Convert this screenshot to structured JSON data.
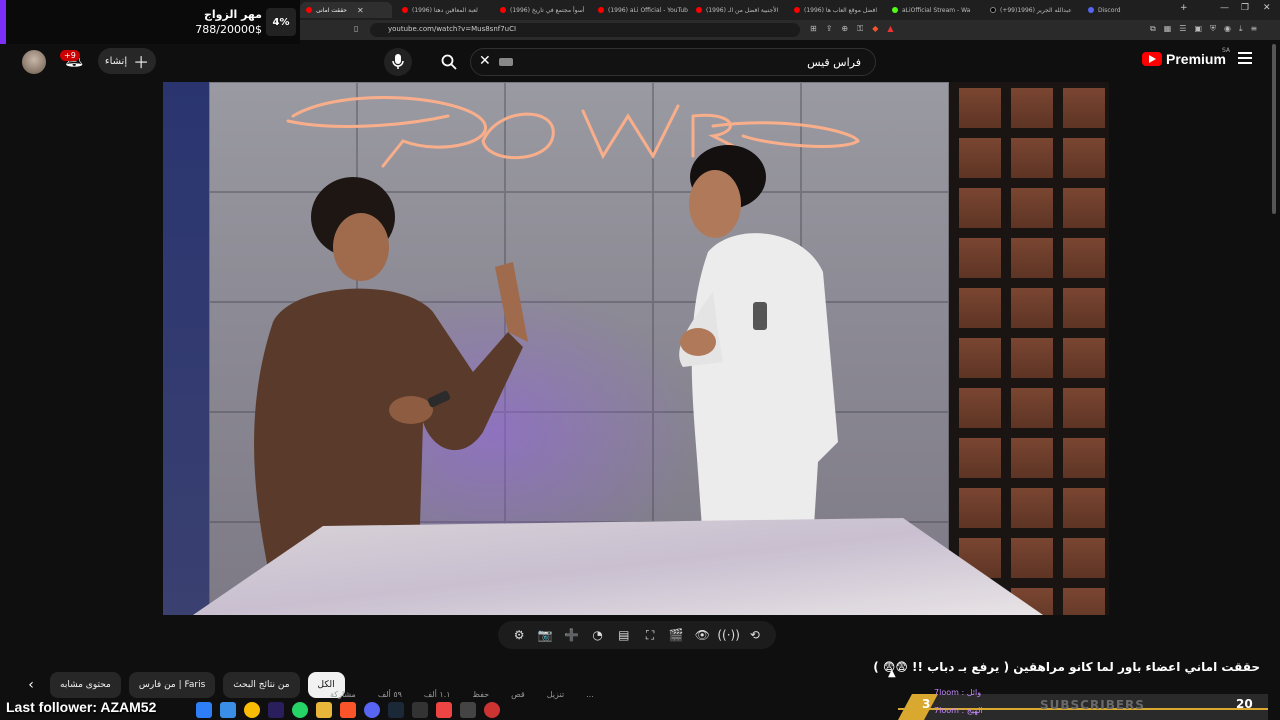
{
  "goal_widget": {
    "title": "مهر الزواج",
    "amount": "788/20000$",
    "percent": "4%",
    "progress": 0.04
  },
  "browser": {
    "tabs": [
      {
        "label": "حققت امانى",
        "active": true
      },
      {
        "label": "(1996) لعبة المعاقين دهتا",
        "active": false
      },
      {
        "label": "(1996) أسوأ مجتمع في تاريخ",
        "active": false
      },
      {
        "label": "(1996) aLi Official - YouTub",
        "active": false
      },
      {
        "label": "(1996) الأجنبية افضل من الـ",
        "active": false
      },
      {
        "label": "(1996) افضل موقع العاب ها",
        "active": false
      },
      {
        "label": "aLiOfficial Stream - Wa",
        "active": false
      },
      {
        "label": "(+99)عبدالله الجرير (1996",
        "active": false
      },
      {
        "label": "Discord",
        "active": false
      }
    ],
    "url": "youtube.com/watch?v=Mus8snf7uCI",
    "new_tab": "+"
  },
  "header": {
    "create_label": "إنشاء",
    "notification_count": "+9",
    "search_query": "فراس قيس",
    "logo_text": "Premium",
    "region": "SA"
  },
  "video": {
    "title": "حققت اماني اعضاء باور لما كانو مراهقين ( يرفع بـ دباب !! 😨😨 )"
  },
  "player_controls": [
    {
      "name": "settings-icon",
      "glyph": "⚙"
    },
    {
      "name": "screenshot-icon",
      "glyph": "📷"
    },
    {
      "name": "add-clip-icon",
      "glyph": "➕"
    },
    {
      "name": "speed-icon",
      "glyph": "◔"
    },
    {
      "name": "subtitles-icon",
      "glyph": "▤"
    },
    {
      "name": "fullscreen-icon",
      "glyph": "⛶"
    },
    {
      "name": "theater-icon",
      "glyph": "🎬"
    },
    {
      "name": "watch-icon",
      "glyph": "👁"
    },
    {
      "name": "cast-icon",
      "glyph": "((·))"
    },
    {
      "name": "loop-icon",
      "glyph": "⟲"
    }
  ],
  "chips": {
    "all": "الكل",
    "from_search": "من نتائج البحث",
    "from_channel": "من فارس | Faris",
    "similar": "محتوى مشابه"
  },
  "partial_row": [
    "مشاركة",
    "٥٩ ألف",
    "١.١ ألف",
    "حفظ",
    "قص",
    "تنزيل",
    "..."
  ],
  "stream_overlay": {
    "last_follower": "Last follower: AZAM52",
    "subscribers_label": "SUBSCRIBERS",
    "subscribers_goal": "20",
    "subscribers_current": "3",
    "zoom_line_1": "وائل : 7loom",
    "zoom_line_2": "الهيج : 7loom"
  },
  "colors": {
    "accent_purple": "#7b2ff7",
    "youtube_red": "#ff0000",
    "background": "#0f0f0f"
  }
}
